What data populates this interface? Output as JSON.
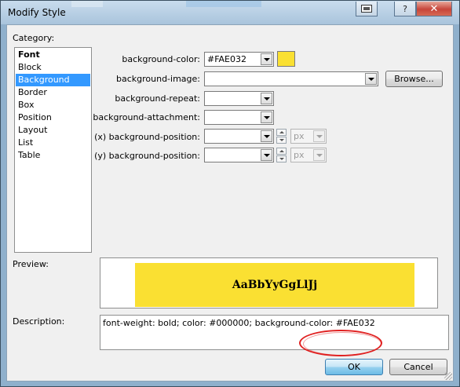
{
  "window": {
    "title": "Modify Style"
  },
  "category": {
    "label": "Category:",
    "items": [
      {
        "label": "Font",
        "bold": true
      },
      {
        "label": "Block"
      },
      {
        "label": "Background",
        "selected": true
      },
      {
        "label": "Border"
      },
      {
        "label": "Box"
      },
      {
        "label": "Position"
      },
      {
        "label": "Layout"
      },
      {
        "label": "List"
      },
      {
        "label": "Table"
      }
    ]
  },
  "fields": {
    "bg_color": {
      "label": "background-color:",
      "value": "#FAE032"
    },
    "bg_image": {
      "label": "background-image:",
      "value": "",
      "browse": "Browse..."
    },
    "bg_repeat": {
      "label": "background-repeat:",
      "value": ""
    },
    "bg_attachment": {
      "label": "background-attachment:",
      "value": ""
    },
    "bg_pos_x": {
      "label": "(x) background-position:",
      "value": "",
      "unit": "px"
    },
    "bg_pos_y": {
      "label": "(y) background-position:",
      "value": "",
      "unit": "px"
    }
  },
  "preview": {
    "label": "Preview:",
    "sample_text": "AaBbYyGgLlJj",
    "background_color": "#FAE032"
  },
  "description": {
    "label": "Description:",
    "text": "font-weight: bold; color: #000000; background-color: #FAE032"
  },
  "buttons": {
    "ok": "OK",
    "cancel": "Cancel"
  },
  "colors": {
    "swatch": "#FAE032",
    "annotation": "#e02020"
  }
}
